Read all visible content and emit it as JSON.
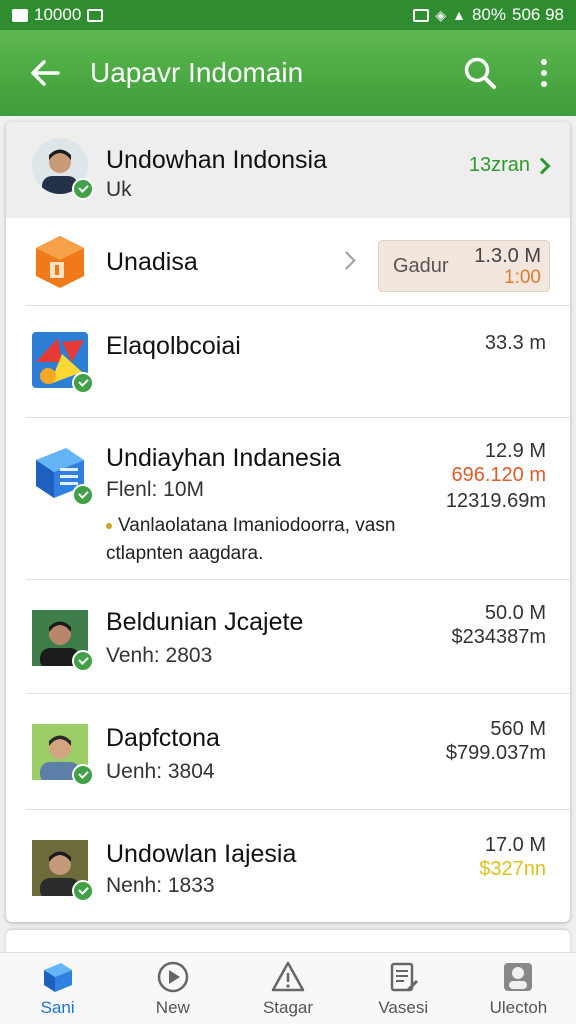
{
  "status_bar": {
    "left_text": "10000",
    "battery": "80%",
    "right_text": "506 98"
  },
  "app_bar": {
    "title": "Uapavr Indomain"
  },
  "items": [
    {
      "name": "Undowhan Indonsia",
      "sub": "Uk",
      "link": "13zran"
    },
    {
      "name": "Unadisa",
      "promo_label": "Gadur",
      "promo_size": "1.3.0 M",
      "promo_extra": "1:00"
    },
    {
      "name": "Elaqolbcoiai",
      "size": "33.3 m"
    },
    {
      "name": "Undiayhan Indanesia",
      "sub": "Flenl: 10M",
      "size": "12.9 M",
      "size_highlight": "696.120 m",
      "size_extra": "12319.69m",
      "desc": "Vanlaolatana Imaniodoorra, vasn ctlapnten aagdara."
    },
    {
      "name": "Beldunian Jcajete",
      "sub": "Venh: 2803",
      "size": "50.0 M",
      "size_extra": "$234387m"
    },
    {
      "name": "Dapfctona",
      "sub": "Uenh: 3804",
      "size": "560 M",
      "size_extra": "$799.037m"
    },
    {
      "name": "Undowlan Iajesia",
      "sub": "Nenh: 1833",
      "size": "17.0 M",
      "size_highlight": "$327nn"
    }
  ],
  "bottom_nav": [
    {
      "label": "Sani"
    },
    {
      "label": "New"
    },
    {
      "label": "Stagar"
    },
    {
      "label": "Vasesi"
    },
    {
      "label": "Ulectoh"
    }
  ],
  "colors": {
    "brand_green": "#3e9d3a",
    "accent_green": "#2e9a2e",
    "nav_active": "#1e73d8",
    "highlight_orange": "#e05a2a",
    "highlight_yellow": "#e0c020"
  }
}
